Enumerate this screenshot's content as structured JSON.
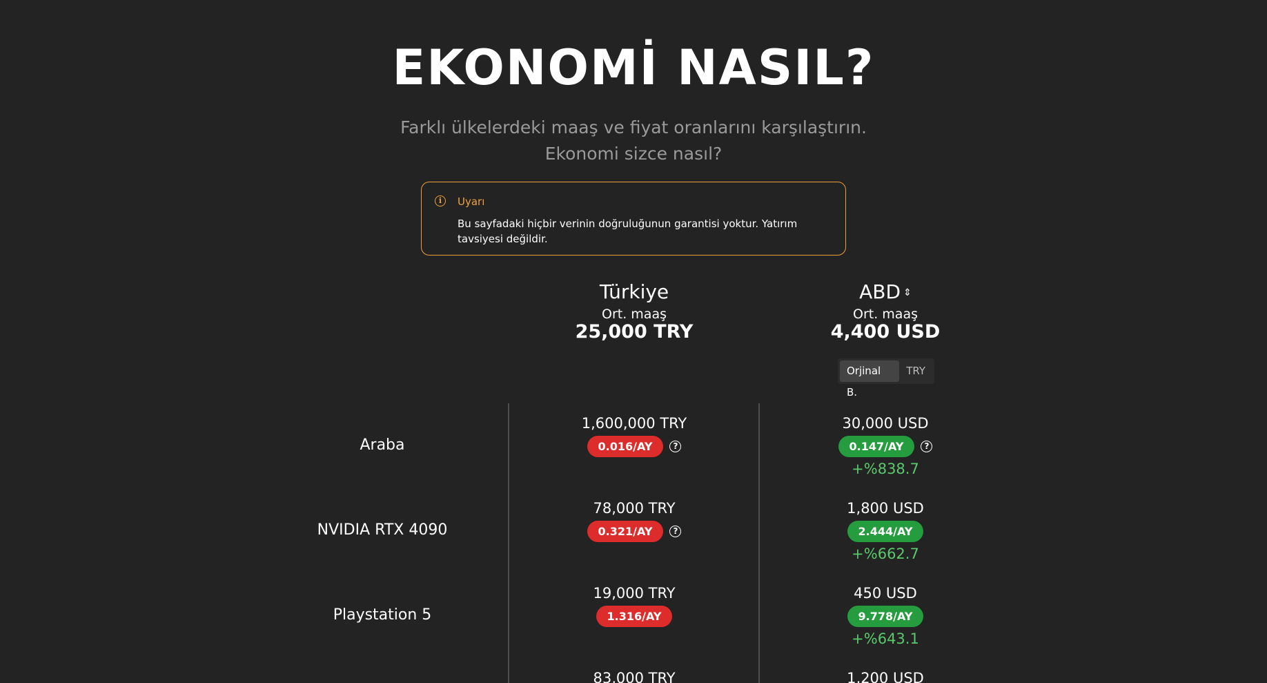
{
  "header": {
    "title": "EKONOMİ NASIL?",
    "subtitle_line1": "Farklı ülkelerdeki maaş ve fiyat oranlarını karşılaştırın.",
    "subtitle_line2": "Ekonomi sizce nasıl?"
  },
  "warning": {
    "icon": "info-icon",
    "title": "Uyarı",
    "text": "Bu sayfadaki hiçbir verinin doğruluğunun garantisi yoktur. Yatırım tavsiyesi değildir.",
    "color": "#f0a13a"
  },
  "columns": {
    "left": {
      "country": "Türkiye",
      "salary_label": "Ort. maaş",
      "salary": "25,000 TRY"
    },
    "right": {
      "country": "ABD",
      "sort_icon": "sort-icon",
      "salary_label": "Ort. maaş",
      "salary": "4,400 USD",
      "toggle": {
        "options": [
          "Orjinal B.",
          "TRY"
        ],
        "selected": "Orjinal B."
      }
    }
  },
  "colors": {
    "bad": "#dc2c2c",
    "good": "#259c3e",
    "diff": "#5ac96b"
  },
  "rows": [
    {
      "name": "Araba",
      "left": {
        "price": "1,600,000 TRY",
        "ratio": "0.016/AY",
        "help": "?"
      },
      "right": {
        "price": "30,000 USD",
        "ratio": "0.147/AY",
        "help": "?",
        "diff": "+%838.7"
      }
    },
    {
      "name": "NVIDIA RTX 4090",
      "left": {
        "price": "78,000 TRY",
        "ratio": "0.321/AY",
        "help": "?"
      },
      "right": {
        "price": "1,800 USD",
        "ratio": "2.444/AY",
        "diff": "+%662.7"
      }
    },
    {
      "name": "Playstation 5",
      "left": {
        "price": "19,000 TRY",
        "ratio": "1.316/AY"
      },
      "right": {
        "price": "450 USD",
        "ratio": "9.778/AY",
        "diff": "+%643.1"
      }
    },
    {
      "name": "",
      "left": {
        "price": "83,000 TRY"
      },
      "right": {
        "price": "1,200 USD"
      }
    }
  ]
}
